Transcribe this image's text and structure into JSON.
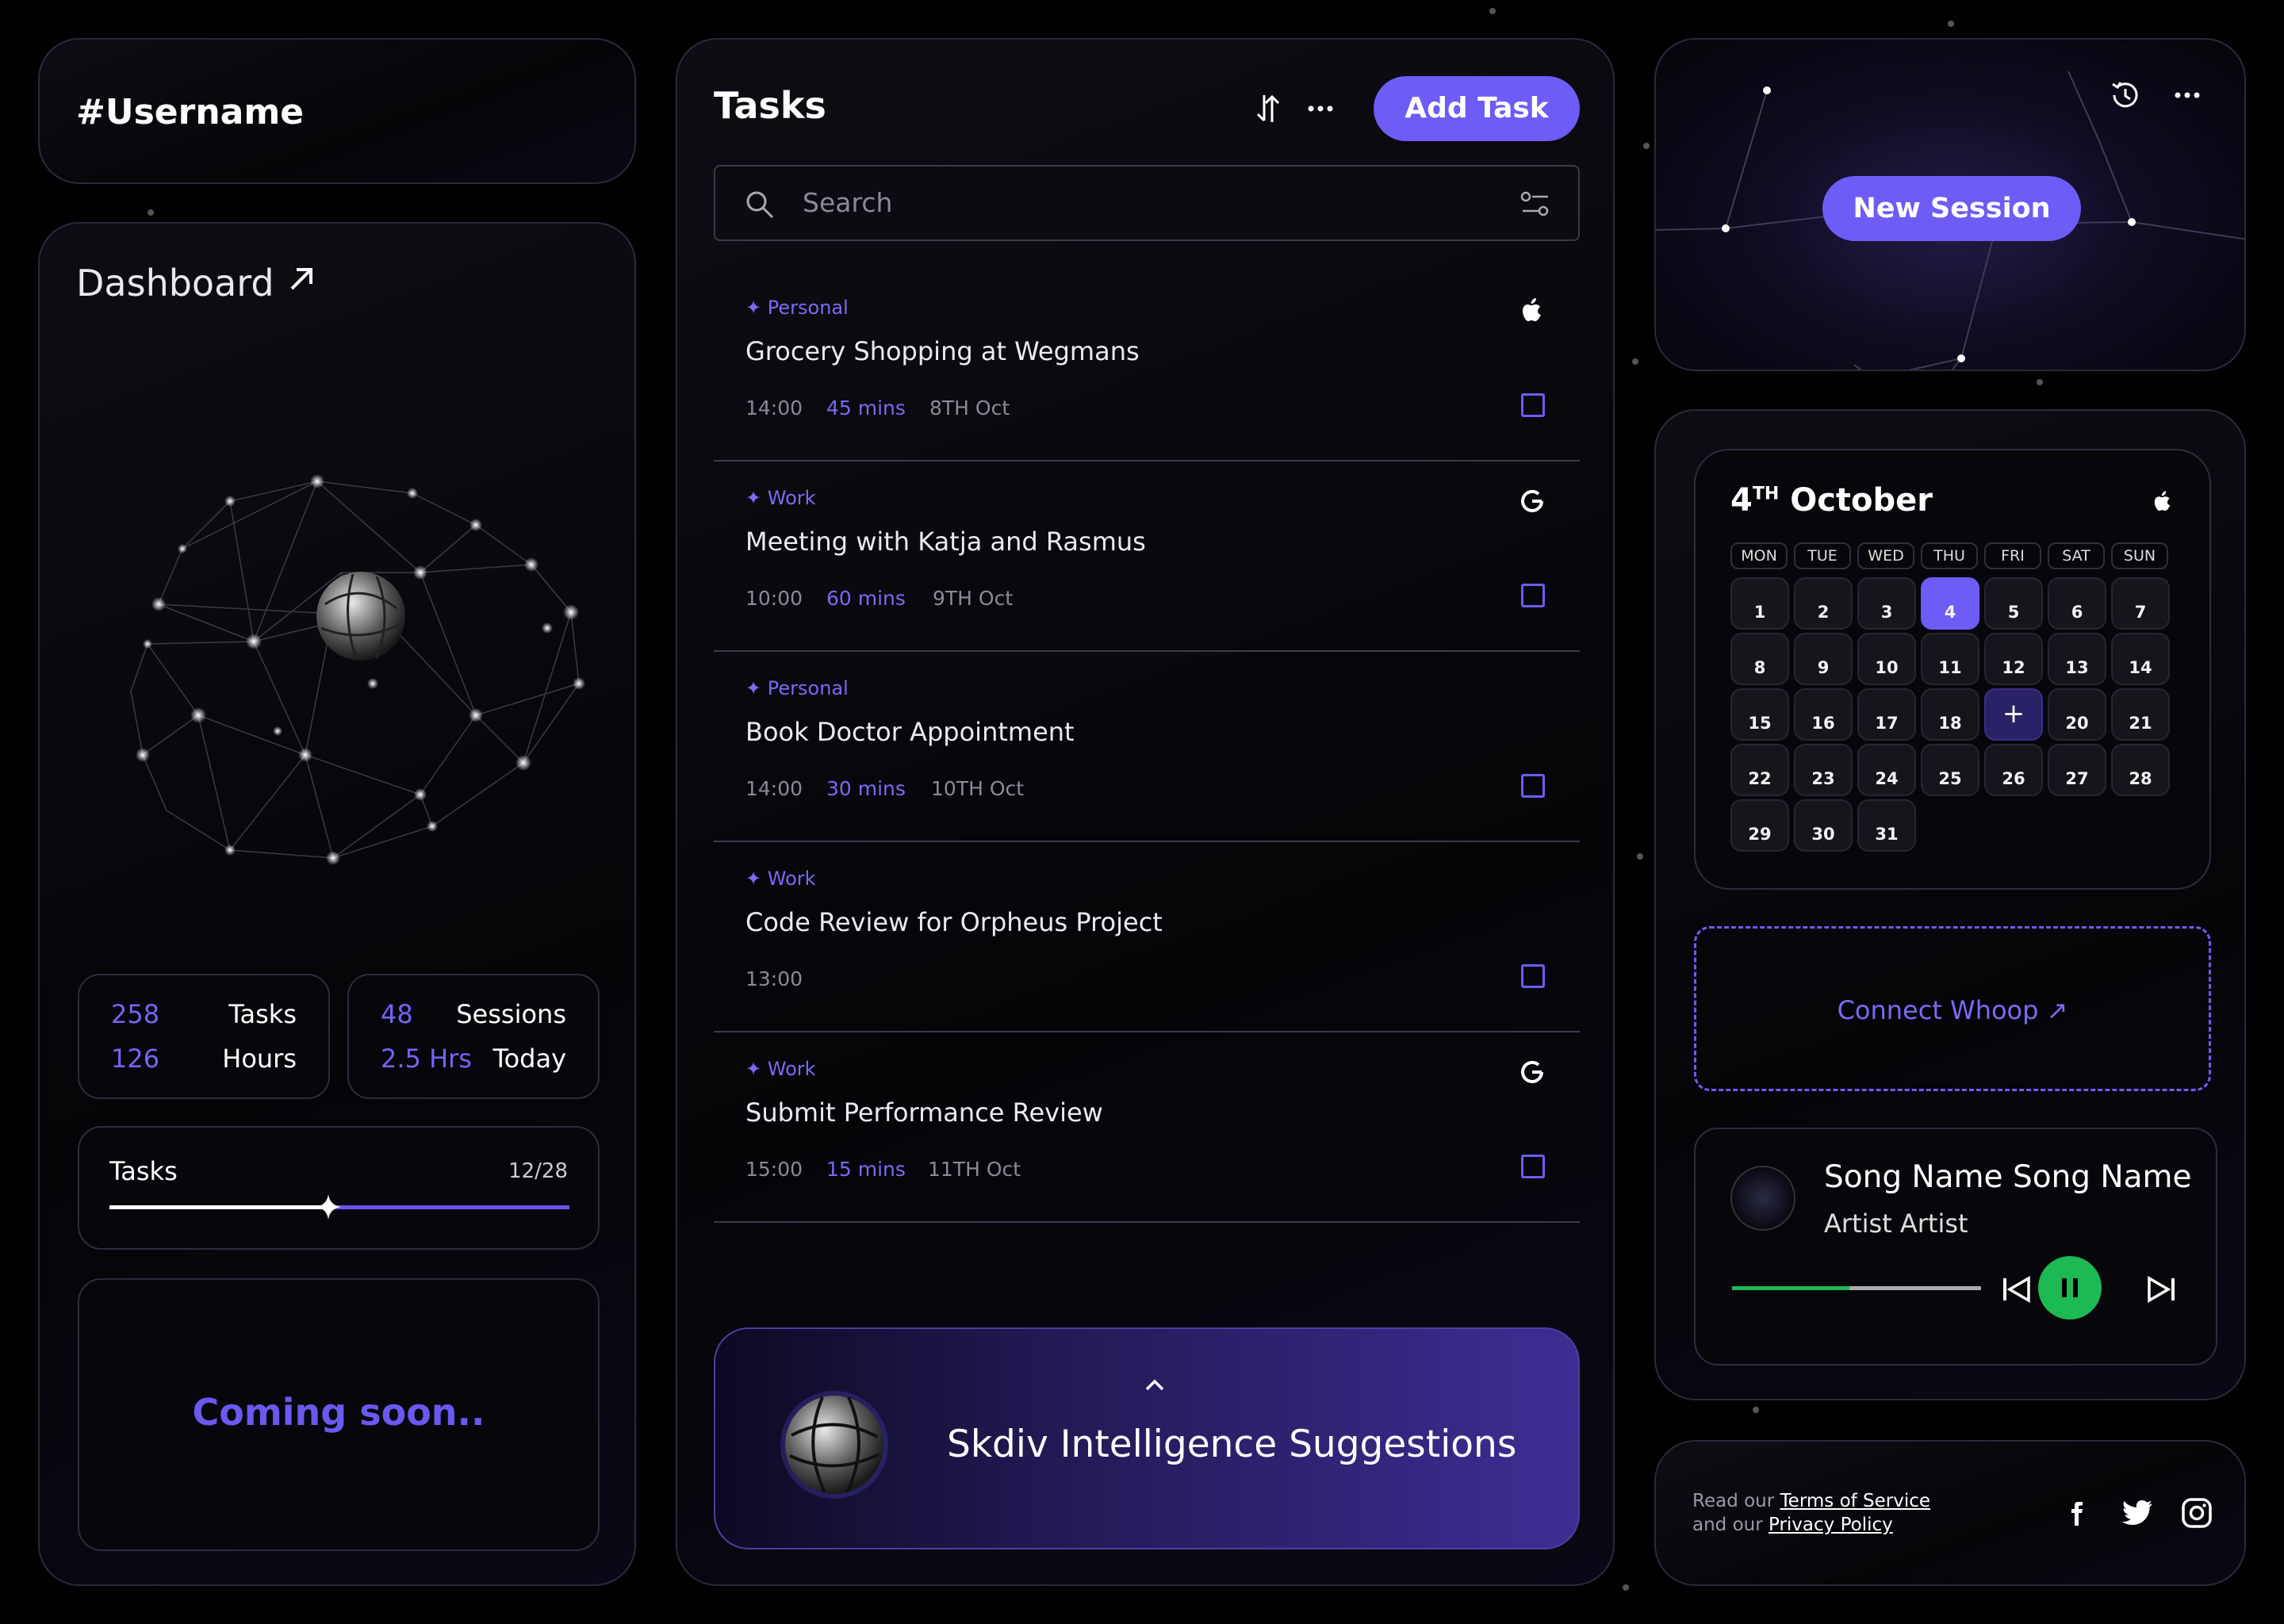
{
  "username": "#Username",
  "dashboard": {
    "title": "Dashboard",
    "stats": [
      {
        "rows": [
          {
            "value": "258",
            "label": "Tasks"
          },
          {
            "value": "126",
            "label": "Hours"
          }
        ]
      },
      {
        "rows": [
          {
            "value": "48",
            "label": "Sessions"
          },
          {
            "value": "2.5 Hrs",
            "label": "Today"
          }
        ]
      }
    ],
    "progress": {
      "label": "Tasks",
      "count": "12/28",
      "fraction": 0.43
    },
    "coming_soon": "Coming soon.."
  },
  "tasks": {
    "title": "Tasks",
    "add_label": "Add Task",
    "search_placeholder": "Search",
    "items": [
      {
        "category": "Personal",
        "title": "Grocery Shopping at Wegmans",
        "time": "14:00",
        "duration": "45 mins",
        "date": "8TH Oct",
        "brand": "apple-icon"
      },
      {
        "category": "Work",
        "title": "Meeting with Katja and Rasmus",
        "time": "10:00",
        "duration": "60 mins",
        "date": "9TH Oct",
        "brand": "google-icon"
      },
      {
        "category": "Personal",
        "title": "Book Doctor Appointment",
        "time": "14:00",
        "duration": "30 mins",
        "date": "10TH Oct",
        "brand": ""
      },
      {
        "category": "Work",
        "title": "Code Review for Orpheus Project",
        "time": "13:00",
        "duration": "",
        "date": "",
        "brand": ""
      },
      {
        "category": "Work",
        "title": "Submit Performance Review",
        "time": "15:00",
        "duration": "15 mins",
        "date": "11TH Oct",
        "brand": "google-icon"
      }
    ],
    "suggestions_label": "Skdiv Intelligence Suggestions"
  },
  "session": {
    "button_label": "New Session"
  },
  "calendar": {
    "day": "4",
    "suffix": "TH",
    "month": "October",
    "weekdays": [
      "MON",
      "TUE",
      "WED",
      "THU",
      "FRI",
      "SAT",
      "SUN"
    ],
    "days": [
      "1",
      "2",
      "3",
      "4",
      "5",
      "6",
      "7",
      "8",
      "9",
      "10",
      "11",
      "12",
      "13",
      "14",
      "15",
      "16",
      "17",
      "18",
      "+",
      "20",
      "21",
      "22",
      "23",
      "24",
      "25",
      "26",
      "27",
      "28",
      "29",
      "30",
      "31"
    ],
    "selected": "4"
  },
  "whoop": {
    "label": "Connect Whoop ↗"
  },
  "player": {
    "song": "Song Name Song Name",
    "artist": "Artist Artist",
    "progress": 0.47
  },
  "footer": {
    "line1_prefix": "Read our ",
    "terms": "Terms of Service",
    "line2_prefix": "and our ",
    "privacy": "Privacy Policy"
  },
  "colors": {
    "accent": "#6d5cf5",
    "spotify_green": "#1db954",
    "background": "#000000"
  }
}
